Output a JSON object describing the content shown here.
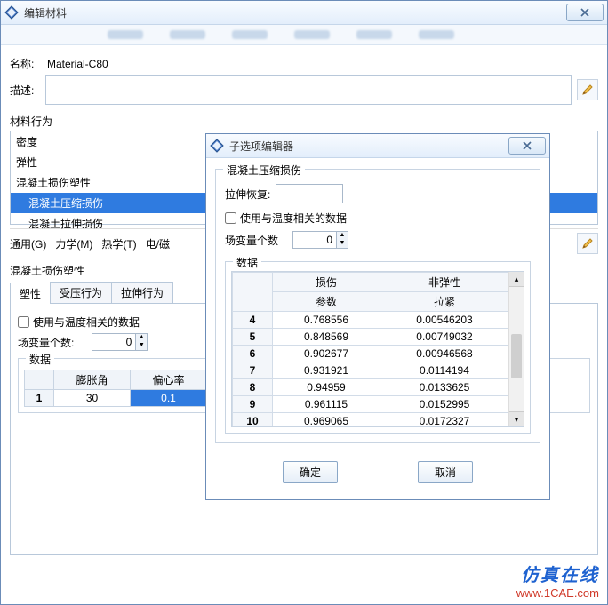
{
  "main": {
    "title": "编辑材料",
    "name_label": "名称:",
    "name_value": "Material-C80",
    "desc_label": "描述:",
    "behavior_title": "材料行为",
    "behavior_items": [
      "密度",
      "弹性",
      "混凝土损伤塑性",
      "混凝土压缩损伤",
      "混凝土拉伸损伤"
    ],
    "menu": {
      "general": "通用(G)",
      "mechanical": "力学(M)",
      "thermal": "热学(T)",
      "electromagnetic": "电/磁"
    },
    "plastic_title": "混凝土损伤塑性",
    "tabs": [
      "塑性",
      "受压行为",
      "拉伸行为"
    ],
    "use_temp": "使用与温度相关的数据",
    "field_vars_label": "场变量个数:",
    "field_vars_value": "0",
    "data_title": "数据",
    "table": {
      "headers": [
        "膨胀角",
        "偏心率"
      ],
      "rownum": "1",
      "cells": [
        "30",
        "0.1"
      ]
    }
  },
  "sub": {
    "title": "子选项编辑器",
    "group_title": "混凝土压缩损伤",
    "tension_recovery_label": "拉伸恢复:",
    "tension_recovery_value": "",
    "use_temp": "使用与温度相关的数据",
    "field_vars_label": "场变量个数",
    "field_vars_value": "0",
    "data_title": "数据",
    "table": {
      "head1a": "损伤",
      "head1b": "参数",
      "head2a": "非弹性",
      "head2b": "拉紧",
      "rows": [
        {
          "n": "4",
          "a": "0.768556",
          "b": "0.00546203"
        },
        {
          "n": "5",
          "a": "0.848569",
          "b": "0.00749032"
        },
        {
          "n": "6",
          "a": "0.902677",
          "b": "0.00946568"
        },
        {
          "n": "7",
          "a": "0.931921",
          "b": "0.0114194"
        },
        {
          "n": "8",
          "a": "0.94959",
          "b": "0.0133625"
        },
        {
          "n": "9",
          "a": "0.961115",
          "b": "0.0152995"
        },
        {
          "n": "10",
          "a": "0.969065",
          "b": "0.0172327"
        }
      ]
    },
    "ok": "确定",
    "cancel": "取消"
  },
  "watermark": {
    "l1": "仿真在线",
    "l2": "www.1CAE.com"
  }
}
